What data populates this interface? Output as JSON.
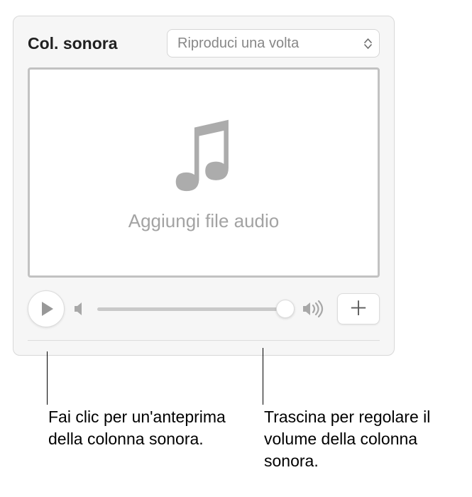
{
  "header": {
    "title": "Col. sonora",
    "dropdown_selected": "Riproduci una volta"
  },
  "dropzone": {
    "placeholder_text": "Aggiungi file audio"
  },
  "controls": {
    "volume_value": 100
  },
  "callouts": {
    "play": "Fai clic per un'anteprima della colonna sonora.",
    "volume": "Trascina per regolare il volume della colonna sonora."
  }
}
